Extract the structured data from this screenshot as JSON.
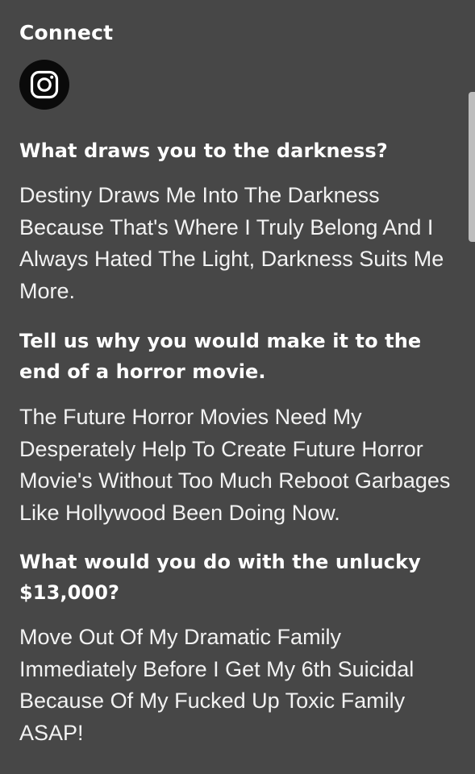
{
  "connect": {
    "title": "Connect",
    "icons": [
      "instagram-icon"
    ]
  },
  "qa": [
    {
      "question": "What draws you to the darkness?",
      "answer": "Destiny Draws Me Into The Darkness Because That's Where I Truly Belong And I Always Hated The Light, Darkness Suits Me More."
    },
    {
      "question": "Tell us why you would make it to the end of a horror movie.",
      "answer": "The Future Horror Movies Need My Desperately Help To Create Future Horror Movie's Without Too Much Reboot Garbages Like Hollywood Been Doing Now."
    },
    {
      "question": "What would you do with the unlucky $13,000?",
      "answer": "Move Out Of My Dramatic Family Immediately Before I Get My 6th Suicidal Because Of My Fucked Up Toxic Family ASAP!"
    }
  ],
  "colors": {
    "background": "#474747",
    "text": "#ffffff",
    "icon_circle": "#0a0a0a",
    "scrollbar": "#bdbdbd"
  }
}
